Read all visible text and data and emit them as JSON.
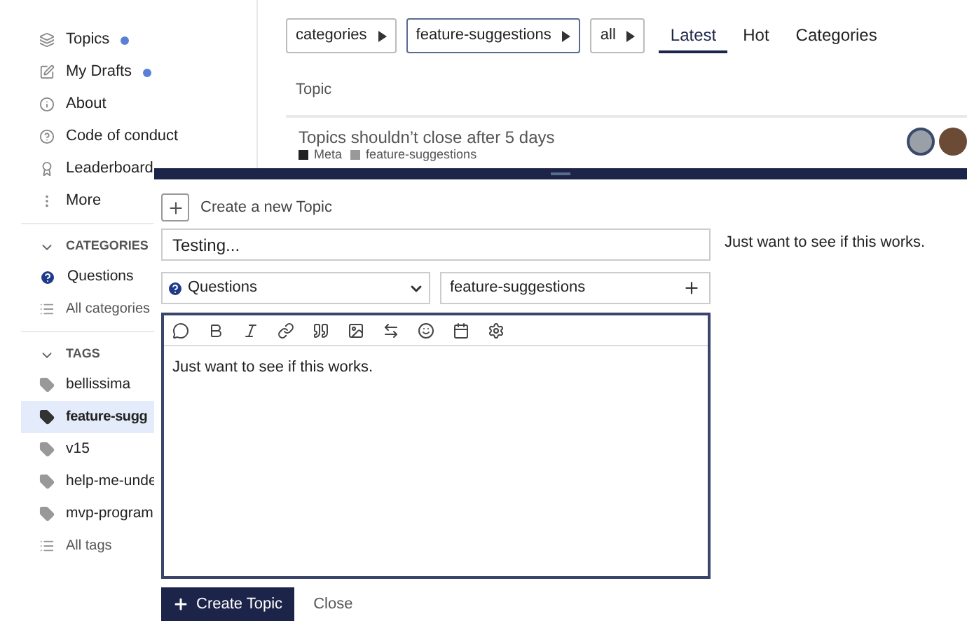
{
  "sidebar": {
    "items": [
      {
        "label": "Topics",
        "unread": true
      },
      {
        "label": "My Drafts",
        "unread": true
      },
      {
        "label": "About",
        "unread": false
      },
      {
        "label": "Code of conduct",
        "unread": false
      },
      {
        "label": "Leaderboard",
        "unread": false
      },
      {
        "label": "More",
        "unread": false
      }
    ],
    "sections": [
      {
        "title": "CATEGORIES",
        "expanded": true,
        "items": [
          {
            "kind": "category",
            "label": "Questions",
            "selected": false
          },
          {
            "kind": "all",
            "label": "All categories",
            "selected": false
          }
        ]
      },
      {
        "title": "TAGS",
        "expanded": true,
        "items": [
          {
            "kind": "tag",
            "label": "bellissima",
            "selected": false
          },
          {
            "kind": "tag",
            "label": "feature-sugg",
            "selected": true
          },
          {
            "kind": "tag",
            "label": "v15",
            "selected": false
          },
          {
            "kind": "tag",
            "label": "help-me-unde",
            "selected": false
          },
          {
            "kind": "tag",
            "label": "mvp-program",
            "selected": false
          },
          {
            "kind": "all",
            "label": "All tags",
            "selected": false
          }
        ]
      }
    ]
  },
  "breadcrumbs": [
    {
      "label": "categories",
      "active": false
    },
    {
      "label": "feature-suggestions",
      "active": true
    },
    {
      "label": "all",
      "active": false
    }
  ],
  "tabs": [
    {
      "label": "Latest",
      "selected": true
    },
    {
      "label": "Hot",
      "selected": false
    },
    {
      "label": "Categories",
      "selected": false
    }
  ],
  "table": {
    "columns": [
      "Topic"
    ],
    "rows": [
      {
        "title": "Topics shouldn’t close after 5 days",
        "category": "Meta",
        "color": "#222222",
        "tag": "feature-suggestions"
      }
    ]
  },
  "composer": {
    "action": "Create a new Topic",
    "title": "Testing...",
    "category": "Questions",
    "tags": "feature-suggestions",
    "body": "Just want to see if this works.",
    "preview": "Just want to see if this works.",
    "submit": "Create Topic",
    "cancel": "Close"
  }
}
